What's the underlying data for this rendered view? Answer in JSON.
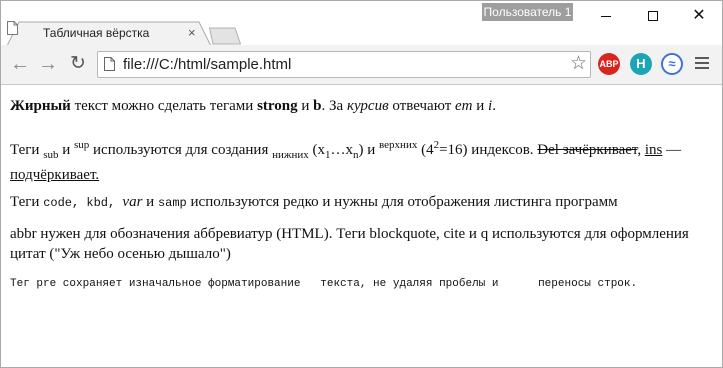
{
  "titlebar": {
    "profile_label": "Пользователь 1"
  },
  "tab": {
    "title": "Табличная вёрстка",
    "close_glyph": "×"
  },
  "toolbar": {
    "url": "file:///C:/html/sample.html",
    "extensions": {
      "abp_label": "ABP",
      "h_label": "H"
    }
  },
  "content": {
    "p1": {
      "bold": "Жирный",
      "t1": " текст можно сделать тегами ",
      "strong": "strong",
      "t2": " и ",
      "b": "b",
      "t3": ". За ",
      "italic": "курсив",
      "t4": " отвечают ",
      "em": "em",
      "t5": " и ",
      "i": "i",
      "t6": "."
    },
    "p2": {
      "t1": "Теги ",
      "sub": "sub",
      "t2": " и ",
      "sup": "sup",
      "t3": " используются для создания ",
      "lower": "нижних",
      "t4": " (x",
      "x1": "1",
      "dots": "…x",
      "xn": "n",
      "t5": ") и ",
      "upper": "верхних",
      "t6": " (4",
      "exp": "2",
      "t7": "=16) индексов. ",
      "del": "Del зачёркивает",
      "t8": ", ",
      "ins": "ins",
      "t9": " — ",
      "underline": "подчёркивает."
    },
    "p3": {
      "t1": "Теги ",
      "code": "code",
      "c1": ", ",
      "kbd": "kbd",
      "c2": ", ",
      "var": "var",
      "t2": " и ",
      "samp": "samp",
      "t3": " используются редко и нужны для отображения листинга программ"
    },
    "p4": {
      "text": "abbr нужен для обозначения аббревиатур (HTML). Теги blockquote, cite и q используются для оформления цитат (\"Уж небо осенью дышало\")"
    },
    "p5": {
      "text": "Тег pre сохраняет изначальное форматирование   текста, не удаляя пробелы и      переносы строк."
    }
  }
}
